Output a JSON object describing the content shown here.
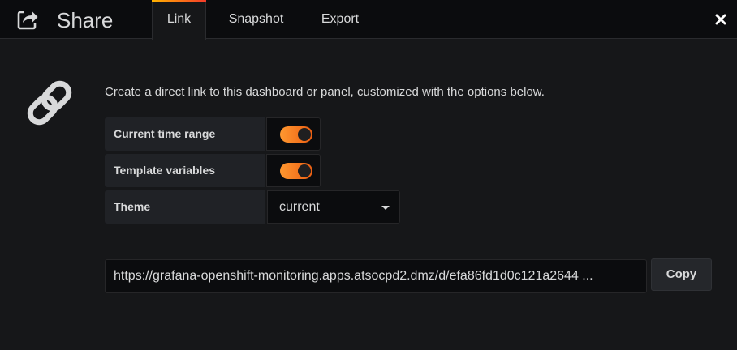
{
  "header": {
    "title": "Share",
    "icon": "share-icon",
    "close_icon": "close-icon",
    "tabs": [
      {
        "label": "Link",
        "active": true
      },
      {
        "label": "Snapshot",
        "active": false
      },
      {
        "label": "Export",
        "active": false
      }
    ]
  },
  "main": {
    "icon": "link-icon",
    "description": "Create a direct link to this dashboard or panel, customized with the options below.",
    "options": [
      {
        "label": "Current time range",
        "enabled": true
      },
      {
        "label": "Template variables",
        "enabled": true
      }
    ],
    "theme": {
      "label": "Theme",
      "value": "current"
    },
    "url": "https://grafana-openshift-monitoring.apps.atsocpd2.dmz/d/efa86fd1d0c121a2644 ...",
    "copy_label": "Copy"
  },
  "colors": {
    "accent_start": "#ff9830",
    "accent_end": "#eb5e12",
    "tab_gradient_start": "#ffb300",
    "tab_gradient_end": "#f53b2a",
    "background": "#161719"
  }
}
